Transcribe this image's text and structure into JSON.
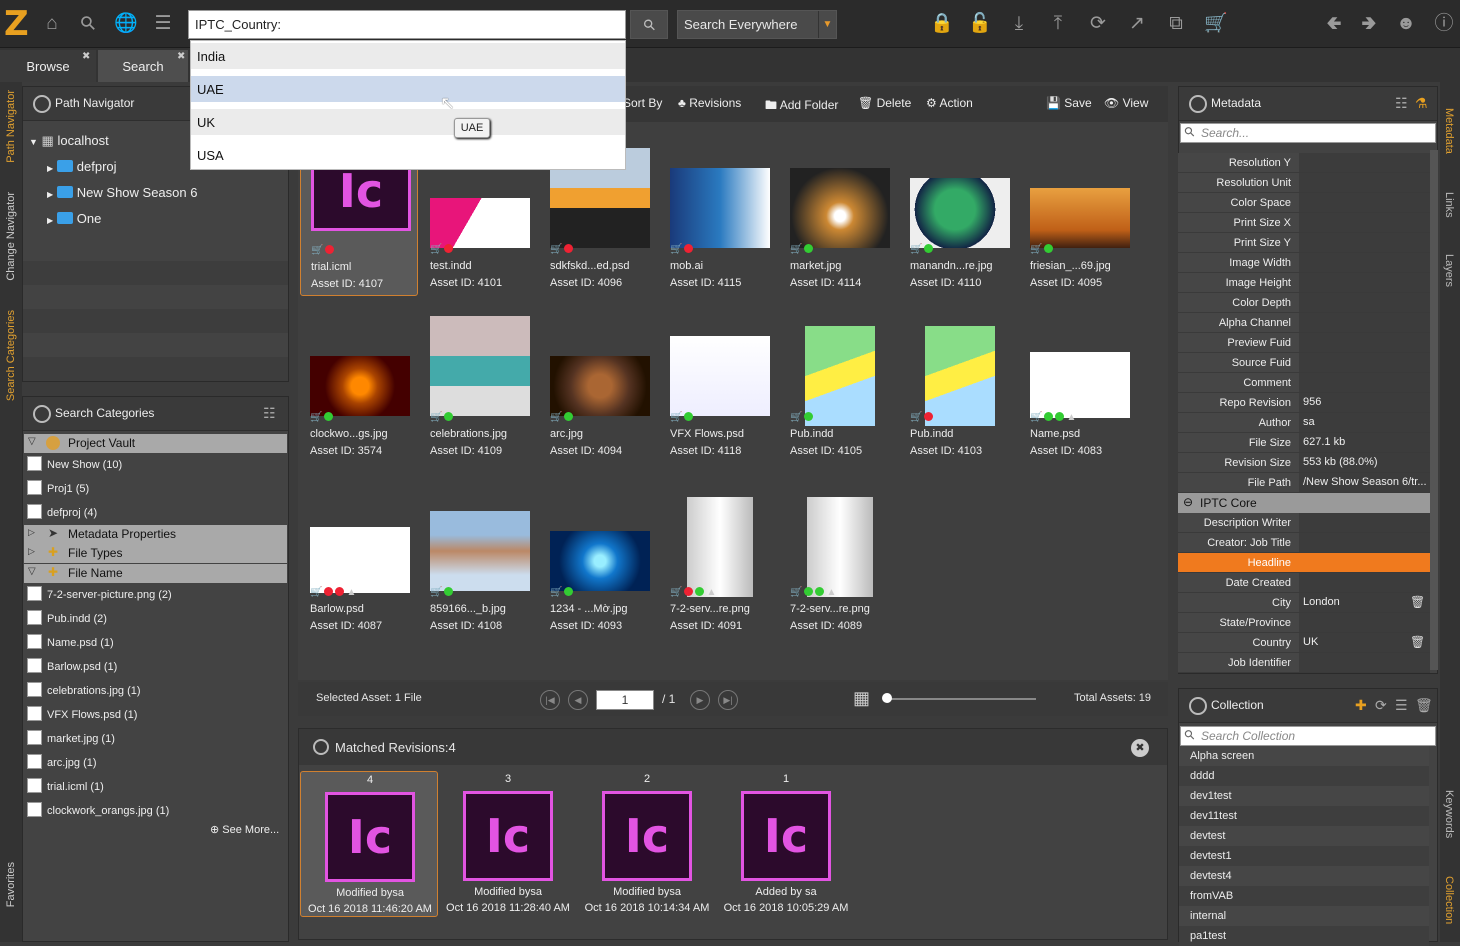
{
  "topbar": {
    "search_value": "IPTC_Country:",
    "scope": "Search Everywhere",
    "dropdown": [
      "India",
      "UAE",
      "UK",
      "USA"
    ],
    "tooltip": "UAE"
  },
  "tabs": {
    "browse": "Browse",
    "search": "Search"
  },
  "left_vtabs": [
    "Path Navigator",
    "Change Navigator",
    "Search Categories",
    "Favorites"
  ],
  "right_vtabs": [
    "Metadata",
    "Links",
    "Layers",
    "Keywords",
    "Collection"
  ],
  "path_navigator": {
    "title": "Path Navigator",
    "root": "localhost",
    "folders": [
      "defproj",
      "New Show Season 6",
      "One"
    ]
  },
  "search_categories": {
    "title": "Search Categories",
    "project_vault": "Project Vault",
    "projects": [
      "New Show (10)",
      "Proj1 (5)",
      "defproj (4)"
    ],
    "metadata_properties": "Metadata Properties",
    "file_types": "File Types",
    "file_name": "File Name",
    "files": [
      "7-2-server-picture.png (2)",
      "Pub.indd (2)",
      "Name.psd (1)",
      "Barlow.psd (1)",
      "celebrations.jpg (1)",
      "VFX Flows.psd (1)",
      "market.jpg (1)",
      "arc.jpg (1)",
      "trial.icml (1)",
      "clockwork_orangs.jpg (1)"
    ],
    "see_more": "See More..."
  },
  "toolbar": {
    "sort_by": "Sort By",
    "revisions": "Revisions",
    "add_folder": "Add Folder",
    "delete": "Delete",
    "action": "Action",
    "save": "Save",
    "view": "View"
  },
  "assets": [
    {
      "name": "trial.icml",
      "id": "Asset ID: 4107"
    },
    {
      "name": "test.indd",
      "id": "Asset ID: 4101"
    },
    {
      "name": "sdkfskd...ed.psd",
      "id": "Asset ID: 4096"
    },
    {
      "name": "mob.ai",
      "id": "Asset ID: 4115"
    },
    {
      "name": "market.jpg",
      "id": "Asset ID: 4114"
    },
    {
      "name": "manandn...re.jpg",
      "id": "Asset ID: 4110"
    },
    {
      "name": "friesian_...69.jpg",
      "id": "Asset ID: 4095"
    },
    {
      "name": "clockwo...gs.jpg",
      "id": "Asset ID: 3574"
    },
    {
      "name": "celebrations.jpg",
      "id": "Asset ID: 4109"
    },
    {
      "name": "arc.jpg",
      "id": "Asset ID: 4094"
    },
    {
      "name": "VFX Flows.psd",
      "id": "Asset ID: 4118"
    },
    {
      "name": "Pub.indd",
      "id": "Asset ID: 4105"
    },
    {
      "name": "Pub.indd",
      "id": "Asset ID: 4103"
    },
    {
      "name": "Name.psd",
      "id": "Asset ID: 4083"
    },
    {
      "name": "Barlow.psd",
      "id": "Asset ID: 4087"
    },
    {
      "name": "859166..._b.jpg",
      "id": "Asset ID: 4108"
    },
    {
      "name": "1234 - ...Mờ.jpg",
      "id": "Asset ID: 4093"
    },
    {
      "name": "7-2-serv...re.png",
      "id": "Asset ID: 4091"
    },
    {
      "name": "7-2-serv...re.png",
      "id": "Asset ID: 4089"
    }
  ],
  "thumb_ic": "Ic",
  "statusbar": {
    "selected": "Selected Asset: 1 File",
    "page": "1",
    "of": "/ 1",
    "total": "Total Assets: 19"
  },
  "revisions_panel": {
    "title": "Matched Revisions:4",
    "items": [
      {
        "num": "4",
        "by": "Modified bysa",
        "date": "Oct 16 2018 11:46:20 AM"
      },
      {
        "num": "3",
        "by": "Modified bysa",
        "date": "Oct 16 2018 11:28:40 AM"
      },
      {
        "num": "2",
        "by": "Modified bysa",
        "date": "Oct 16 2018 10:14:34 AM"
      },
      {
        "num": "1",
        "by": "Added by sa",
        "date": "Oct 16 2018 10:05:29 AM"
      }
    ]
  },
  "metadata": {
    "title": "Metadata",
    "search_placeholder": "Search...",
    "rows": [
      {
        "k": "Resolution Y",
        "v": ""
      },
      {
        "k": "Resolution Unit",
        "v": ""
      },
      {
        "k": "Color Space",
        "v": ""
      },
      {
        "k": "Print Size X",
        "v": ""
      },
      {
        "k": "Print Size Y",
        "v": ""
      },
      {
        "k": "Image Width",
        "v": ""
      },
      {
        "k": "Image Height",
        "v": ""
      },
      {
        "k": "Color Depth",
        "v": ""
      },
      {
        "k": "Alpha Channel",
        "v": ""
      },
      {
        "k": "Preview Fuid",
        "v": ""
      },
      {
        "k": "Source Fuid",
        "v": ""
      },
      {
        "k": "Comment",
        "v": ""
      },
      {
        "k": "Repo Revision",
        "v": "956"
      },
      {
        "k": "Author",
        "v": "sa"
      },
      {
        "k": "File Size",
        "v": "627.1 kb"
      },
      {
        "k": "Revision Size",
        "v": "553 kb (88.0%)"
      },
      {
        "k": "File Path",
        "v": "/New Show Season 6/tr..."
      }
    ],
    "iptc_section": "IPTC Core",
    "iptc_rows": [
      {
        "k": "Description Writer",
        "v": ""
      },
      {
        "k": "Creator: Job Title",
        "v": ""
      },
      {
        "k": "Headline",
        "v": ""
      },
      {
        "k": "Date Created",
        "v": ""
      },
      {
        "k": "City",
        "v": "London"
      },
      {
        "k": "State/Province",
        "v": ""
      },
      {
        "k": "Country",
        "v": "UK"
      },
      {
        "k": "Job Identifier",
        "v": ""
      }
    ]
  },
  "collection": {
    "title": "Collection",
    "search_placeholder": "Search Collection",
    "items": [
      "Alpha screen",
      "dddd",
      "dev1test",
      "dev11test",
      "devtest",
      "devtest1",
      "devtest4",
      "fromVAB",
      "internal",
      "pa1test"
    ]
  }
}
